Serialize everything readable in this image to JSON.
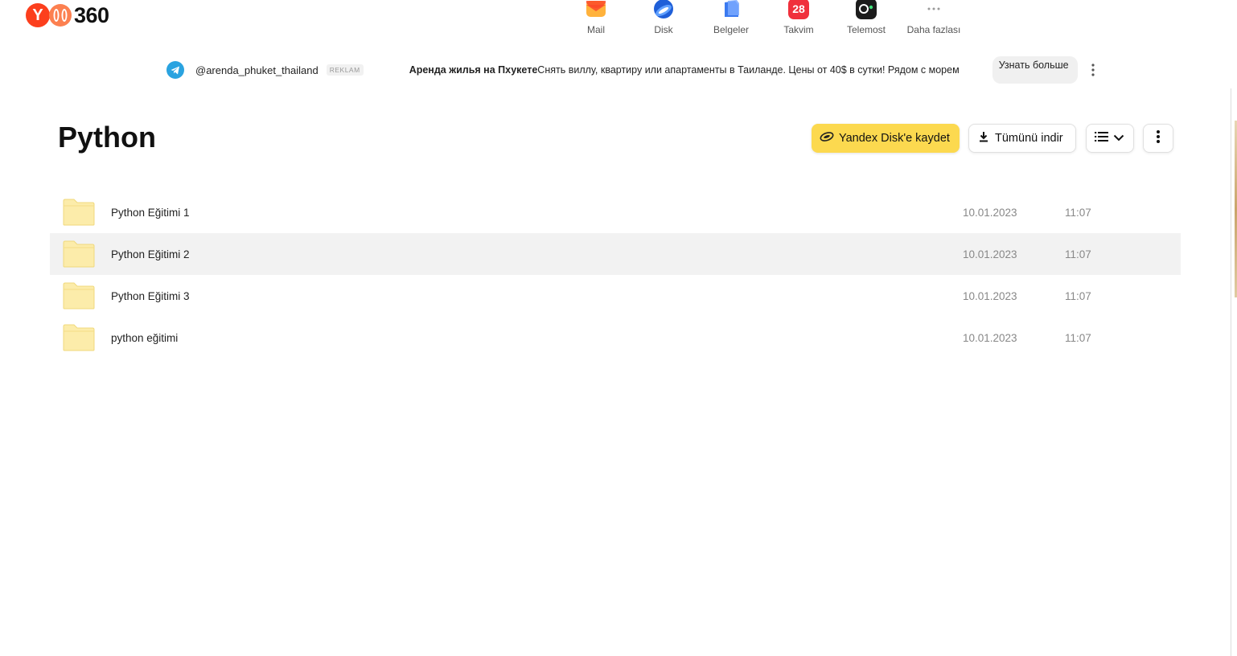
{
  "header": {
    "logo_letter": "Y",
    "logo_text": "360",
    "services": [
      {
        "label": "Mail",
        "icon": "mail-icon",
        "color": "#fc8a3c"
      },
      {
        "label": "Disk",
        "icon": "disk-icon",
        "color": "#2b6fe0"
      },
      {
        "label": "Belgeler",
        "icon": "documents-icon",
        "color": "#4a86f0"
      },
      {
        "label": "Takvim",
        "icon": "calendar-icon",
        "color": "#f0303c",
        "badge": "28"
      },
      {
        "label": "Telemost",
        "icon": "telemost-icon",
        "color": "#1a1a1a"
      },
      {
        "label": "Daha fazlası",
        "icon": "more-dots-icon",
        "color": "#9a9a9a"
      }
    ]
  },
  "ad": {
    "channel": "@arenda_phuket_thailand",
    "badge": "REKLAM",
    "headline": "Аренда жилья на Пхукете",
    "text": "Снять виллу, квартиру или апартаменты в Таиланде. Цены от 40$ в сутки! Рядом с морем",
    "button": "Узнать больше"
  },
  "page": {
    "title": "Python",
    "toolbar": {
      "save_label": "Yandex Disk'e kaydet",
      "download_label": "Tümünü indir"
    }
  },
  "files": [
    {
      "name": "Python Eğitimi 1",
      "date": "10.01.2023",
      "time": "11:07"
    },
    {
      "name": "Python Eğitimi 2",
      "date": "10.01.2023",
      "time": "11:07"
    },
    {
      "name": "Python Eğitimi 3",
      "date": "10.01.2023",
      "time": "11:07"
    },
    {
      "name": "python eğitimi",
      "date": "10.01.2023",
      "time": "11:07"
    }
  ],
  "colors": {
    "accent_yellow": "#fcd94f",
    "row_hover": "#f2f2f2",
    "folder_fill": "#fcecaa",
    "folder_stroke": "#f0d97c"
  }
}
